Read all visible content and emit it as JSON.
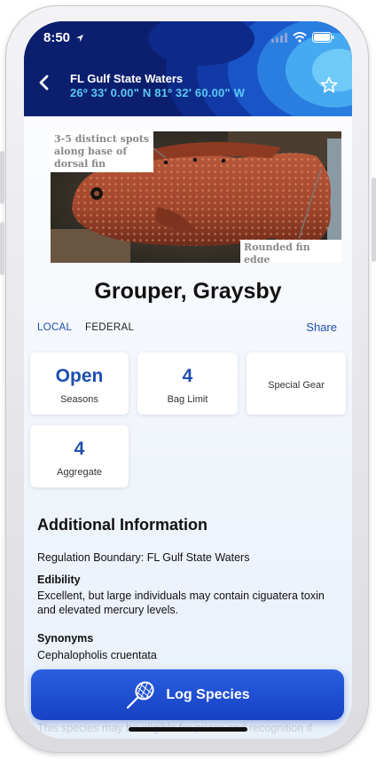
{
  "status_bar": {
    "time": "8:50"
  },
  "header": {
    "location_title": "FL Gulf State Waters",
    "coordinates": "26º 33′ 0.00\" N 81º 32′ 60.00\" W"
  },
  "image": {
    "callout_top": "3-5 distinct spots along base of dorsal fin",
    "callout_bottom": "Rounded fin edge"
  },
  "species": {
    "name": "Grouper, Graysby"
  },
  "tabs": {
    "local": "LOCAL",
    "federal": "FEDERAL",
    "share": "Share"
  },
  "cards": [
    {
      "value": "Open",
      "label": "Seasons"
    },
    {
      "value": "4",
      "label": "Bag Limit"
    },
    {
      "value": "",
      "label": "Special Gear"
    },
    {
      "value": "4",
      "label": "Aggregate"
    }
  ],
  "additional": {
    "title": "Additional Information",
    "boundary": "Regulation Boundary: FL Gulf State Waters",
    "edibility_label": "Edibility",
    "edibility_text": "Excellent, but large individuals may contain ciguatera toxin and elevated mercury levels.",
    "synonyms_label": "Synonyms",
    "synonyms_text": "Cephalopholis cruentata",
    "footer_fade": "This species may be eligible for prizes and recognition if"
  },
  "log_button": {
    "label": "Log Species"
  },
  "colors": {
    "accent": "#1d4fb0",
    "header_bg": "#0b1f6e",
    "coords": "#5cc8f5"
  }
}
